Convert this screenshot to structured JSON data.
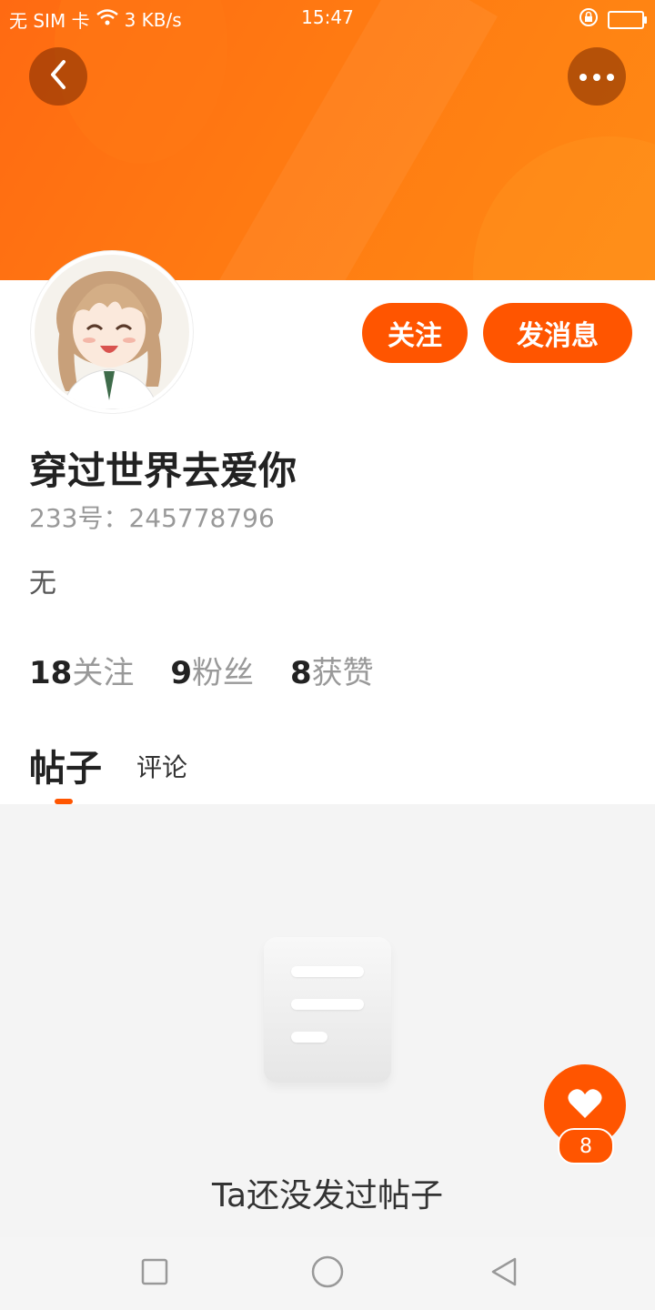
{
  "status_bar": {
    "carrier": "无 SIM 卡",
    "speed": "3 KB/s",
    "time": "15:47"
  },
  "header": {
    "back_icon": "chevron-left-icon",
    "more_icon": "more-horizontal-icon"
  },
  "profile": {
    "avatar": "anime-girl-avatar",
    "follow_label": "关注",
    "message_label": "发消息",
    "username": "穿过世界去爱你",
    "account_id": "233号：245778796",
    "bio": "无",
    "stats": [
      {
        "num": "18",
        "label": "关注"
      },
      {
        "num": "9",
        "label": "粉丝"
      },
      {
        "num": "8",
        "label": "获赞"
      }
    ]
  },
  "tabs": {
    "posts": "帖子",
    "comments": "评论"
  },
  "empty_state": {
    "text": "Ta还没发过帖子",
    "icon": "document-icon"
  },
  "fab": {
    "icon": "heart-icon",
    "count": "8"
  },
  "colors": {
    "accent": "#ff5500",
    "banner": "#ff7a12"
  }
}
